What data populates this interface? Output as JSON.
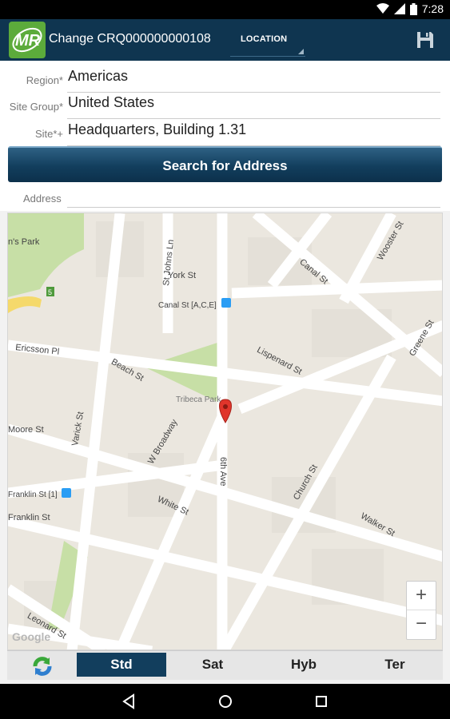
{
  "status_bar": {
    "time": "7:28",
    "icons": [
      "wifi-icon",
      "signal-icon",
      "battery-icon"
    ]
  },
  "app_bar": {
    "title": "Change CRQ000000000108",
    "location_label": "LOCATION",
    "logo_text": "MR"
  },
  "form": {
    "region": {
      "label": "Region*",
      "value": "Americas"
    },
    "site_group": {
      "label": "Site Group*",
      "value": "United States"
    },
    "site": {
      "label": "Site*+",
      "value": "Headquarters, Building 1.31"
    },
    "search_button": "Search for Address",
    "address": {
      "label": "Address",
      "value": ""
    }
  },
  "map": {
    "labels": {
      "park": "n's Park",
      "york": "York St",
      "johns": "St Johns Ln",
      "canal_ace": "Canal St [A,C,E]",
      "canal": "Canal St",
      "wooster": "Wooster St",
      "greene": "Greene St",
      "ericsson": "Ericsson Pl",
      "beach": "Beach St",
      "lispenard": "Lispenard St",
      "tribeca": "Tribeca Park",
      "moore": "Moore St",
      "varick": "Varick St",
      "broadway": "W Broadway",
      "sixth": "6th Ave",
      "church": "Church St",
      "franklin1": "Franklin St [1]",
      "franklin": "Franklin St",
      "white": "White St",
      "walker": "Walker St",
      "leonard": "Leonard St",
      "google": "Google"
    },
    "route_badge": "5",
    "zoom_in": "+",
    "zoom_out": "−"
  },
  "bottom_tabs": [
    "Std",
    "Sat",
    "Hyb",
    "Ter"
  ],
  "active_tab": "Std",
  "colors": {
    "app_bar": "#0f3550",
    "logo": "#5cab3b",
    "active_tab": "#123e5d",
    "marker": "#e0352b",
    "park": "#c7dfa6"
  }
}
